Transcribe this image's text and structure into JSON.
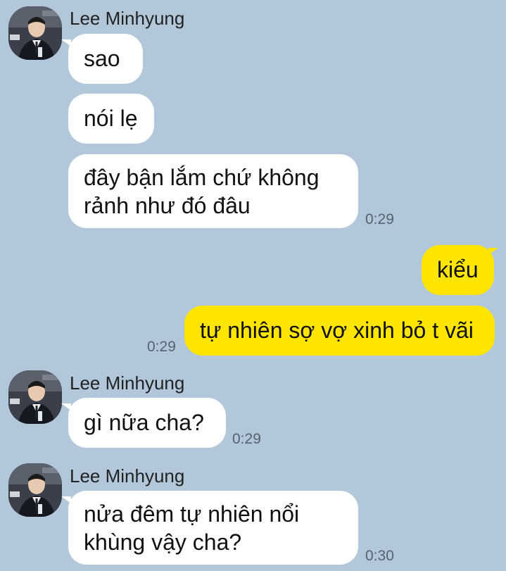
{
  "chat": {
    "groups": [
      {
        "sender": "Lee Minhyung",
        "avatar": "profile-photo",
        "messages": [
          {
            "text": "sao"
          },
          {
            "text": "nói lẹ"
          },
          {
            "lines": [
              "đây bận lắm chứ không",
              "rảnh như đó đâu"
            ],
            "time": "0:29"
          }
        ]
      },
      {
        "sender": "me",
        "messages": [
          {
            "text": "kiểu"
          },
          {
            "text": "tự nhiên sợ vợ xinh bỏ t vãi",
            "time": "0:29"
          }
        ]
      },
      {
        "sender": "Lee Minhyung",
        "avatar": "profile-photo",
        "messages": [
          {
            "text": "gì nữa cha?",
            "time": "0:29"
          }
        ]
      },
      {
        "sender": "Lee Minhyung",
        "avatar": "profile-photo",
        "messages": [
          {
            "lines": [
              "nửa đêm tự nhiên nổi",
              "khùng vậy cha?"
            ],
            "time": "0:30"
          }
        ]
      }
    ]
  },
  "colors": {
    "background": "#b2c7da",
    "incoming_bubble": "#ffffff",
    "outgoing_bubble": "#fee500",
    "timestamp": "#556270"
  }
}
